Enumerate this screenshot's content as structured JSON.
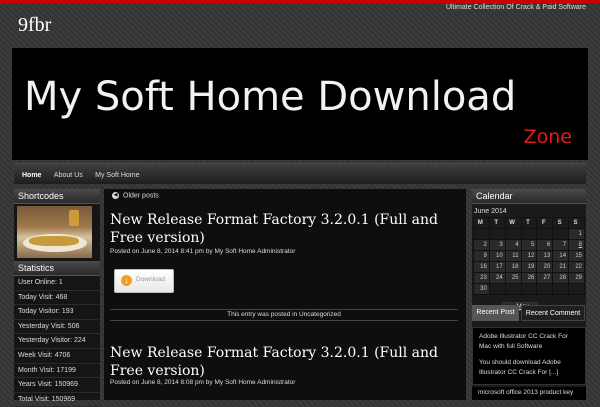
{
  "header": {
    "site_title": "9fbr",
    "tagline": "Ultimate Collection Of Crack & Paid Software"
  },
  "banner": {
    "title": "My Soft Home Download",
    "subtitle": "Zone"
  },
  "nav": {
    "items": [
      {
        "label": "Home",
        "active": true
      },
      {
        "label": "About Us",
        "active": false
      },
      {
        "label": "My Soft Home",
        "active": false
      }
    ]
  },
  "left_sidebar": {
    "shortcodes_title": "Shortcodes",
    "statistics_title": "Statistics",
    "stats": [
      "User Online: 1",
      "Today Visit: 468",
      "Today Visitor: 193",
      "Yesterday Visit: 506",
      "Yesterday Visitor: 224",
      "Week Visit: 4706",
      "Month Visit: 17199",
      "Years Visit: 150969",
      "Total Visit: 150969"
    ]
  },
  "content": {
    "older_posts": "Older posts",
    "posts": [
      {
        "title": "New Release Format Factory 3.2.0.1 (Full and Free version)",
        "meta_prefix": "Posted on",
        "date": "June 8, 2014 8:41 pm",
        "meta_by": "by",
        "author": "My Soft Home Administrator",
        "download_label": "Download",
        "category_text": "This entry was posted in Uncategorized"
      },
      {
        "title": "New Release Format Factory 3.2.0.1 (Full and Free version)",
        "meta_prefix": "Posted on",
        "date": "June 8, 2014 8:08 pm",
        "meta_by": "by",
        "author": "My Soft Home Administrator"
      }
    ]
  },
  "right_sidebar": {
    "calendar_title": "Calendar",
    "month": "June 2014",
    "weekdays": [
      "M",
      "T",
      "W",
      "T",
      "F",
      "S",
      "S"
    ],
    "weeks": [
      [
        "",
        "",
        "",
        "",
        "",
        "",
        "1"
      ],
      [
        "2",
        "3",
        "4",
        "5",
        "6",
        "7",
        "8"
      ],
      [
        "9",
        "10",
        "11",
        "12",
        "13",
        "14",
        "15"
      ],
      [
        "16",
        "17",
        "18",
        "19",
        "20",
        "21",
        "22"
      ],
      [
        "23",
        "24",
        "25",
        "26",
        "27",
        "28",
        "29"
      ],
      [
        "30",
        "",
        "",
        "",
        "",
        "",
        ""
      ]
    ],
    "prev_link": "« May",
    "tabs": [
      "Recent Post",
      "Recent Comment"
    ],
    "recent_items": [
      "Adobe Illustrator CC Crack For Mac with full Software",
      "You should download Adobe Illustrator CC Crack For [...]",
      "microsoft office 2013 product key"
    ]
  }
}
